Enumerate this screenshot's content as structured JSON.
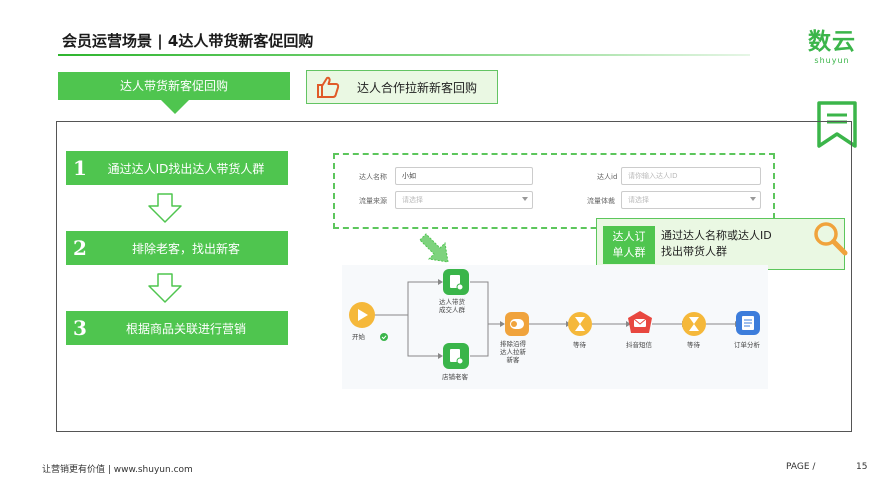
{
  "header": {
    "title": "会员运营场景 | 4达人带货新客促回购",
    "logo_cn": "数云",
    "logo_en": "shuyun"
  },
  "tabs": {
    "active_label": "达人带货新客促回购",
    "sub_label": "达人合作拉新新客回购"
  },
  "steps": [
    {
      "num": "1",
      "text": "通过达人ID找出达人带货人群"
    },
    {
      "num": "2",
      "text": "排除老客，找出新客"
    },
    {
      "num": "3",
      "text": "根据商品关联进行营销"
    }
  ],
  "form": {
    "row1_label_left": "达人名称",
    "row1_value_left": "小如",
    "row1_label_right": "达人id",
    "row1_placeholder_right": "请你输入达人ID",
    "row2_label_left": "流量来源",
    "row2_placeholder_left": "请选择",
    "row2_label_right": "流量体裁",
    "row2_placeholder_right": "请选择"
  },
  "callout": {
    "tag_line1": "达人订",
    "tag_line2": "单人群",
    "text_line1": "通过达人名称或达人ID",
    "text_line2": "找出带货人群"
  },
  "flow": {
    "start": "开始",
    "top_branch_line1": "达人带货",
    "top_branch_line2": "成交人群",
    "bottom_branch": "店铺老客",
    "exclude_line1": "排除沿得",
    "exclude_line2": "达人拉新",
    "exclude_line3": "新客",
    "wait1": "等待",
    "sms": "抖音短信",
    "wait2": "等待",
    "analysis": "订单分析"
  },
  "colors": {
    "brand_green": "#4fc54f",
    "light_green": "#eaf8e3",
    "icon_orange": "#f0a33c"
  },
  "footer": {
    "slogan": "让营销更有价值  |  www.shuyun.com",
    "page_label": "PAGE /",
    "page_number": "15"
  }
}
